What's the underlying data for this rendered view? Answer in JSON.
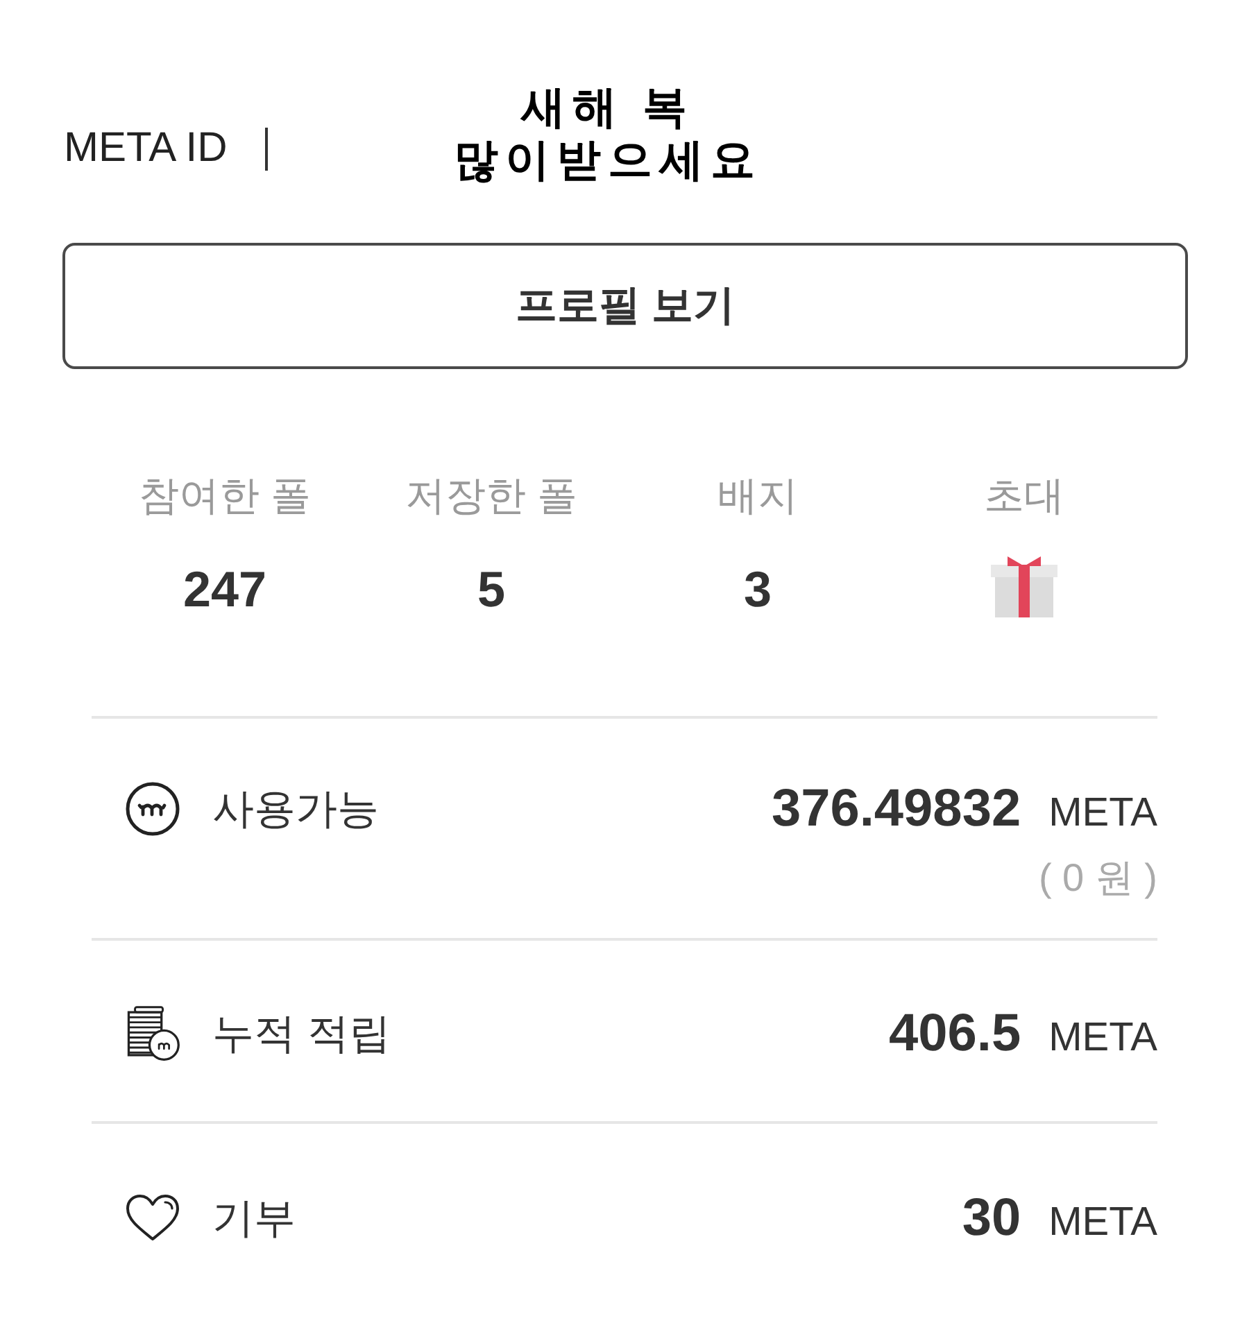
{
  "header": {
    "label": "META ID",
    "greeting": "새해 복\n많이받으세요"
  },
  "profile_button": {
    "label": "프로필 보기"
  },
  "stats": [
    {
      "kind": "count",
      "label": "참여한 폴",
      "value": "247"
    },
    {
      "kind": "count",
      "label": "저장한 폴",
      "value": "5"
    },
    {
      "kind": "count",
      "label": "배지",
      "value": "3"
    },
    {
      "kind": "invite",
      "label": "초대"
    }
  ],
  "balances": [
    {
      "kind": "available",
      "label": "사용가능",
      "amount": "376.49832",
      "unit": "META",
      "note": "( 0 원 )"
    },
    {
      "kind": "earned",
      "label": "누적 적립",
      "amount": "406.5",
      "unit": "META"
    },
    {
      "kind": "donated",
      "label": "기부",
      "amount": "30",
      "unit": "META"
    }
  ]
}
